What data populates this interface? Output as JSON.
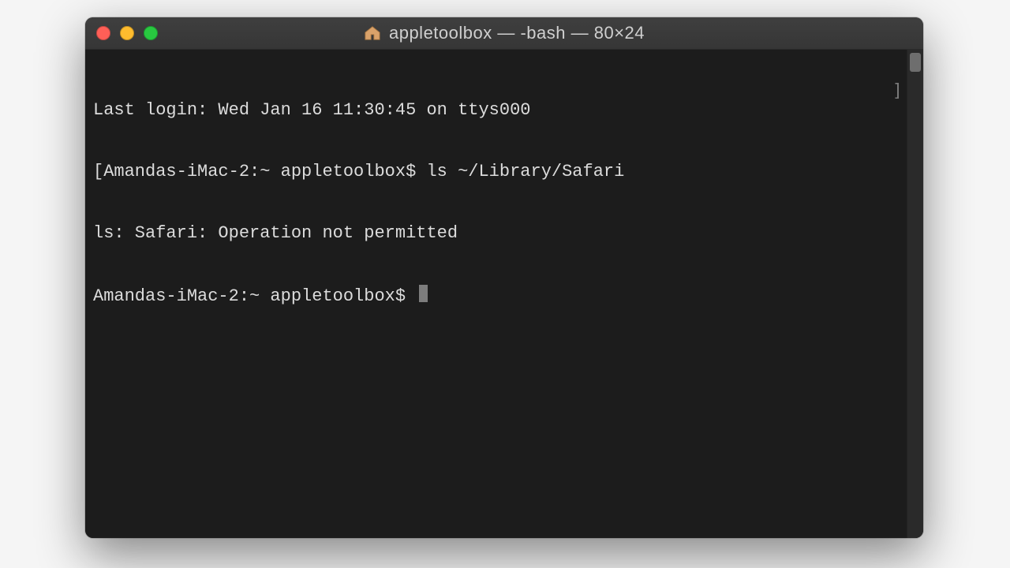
{
  "window": {
    "title": "appletoolbox — -bash — 80×24",
    "home_icon": "🏠"
  },
  "terminal": {
    "lines": [
      "Last login: Wed Jan 16 11:30:45 on ttys000",
      "[Amandas-iMac-2:~ appletoolbox$ ls ~/Library/Safari",
      "ls: Safari: Operation not permitted",
      "Amandas-iMac-2:~ appletoolbox$ "
    ],
    "idle_bracket": "]"
  }
}
